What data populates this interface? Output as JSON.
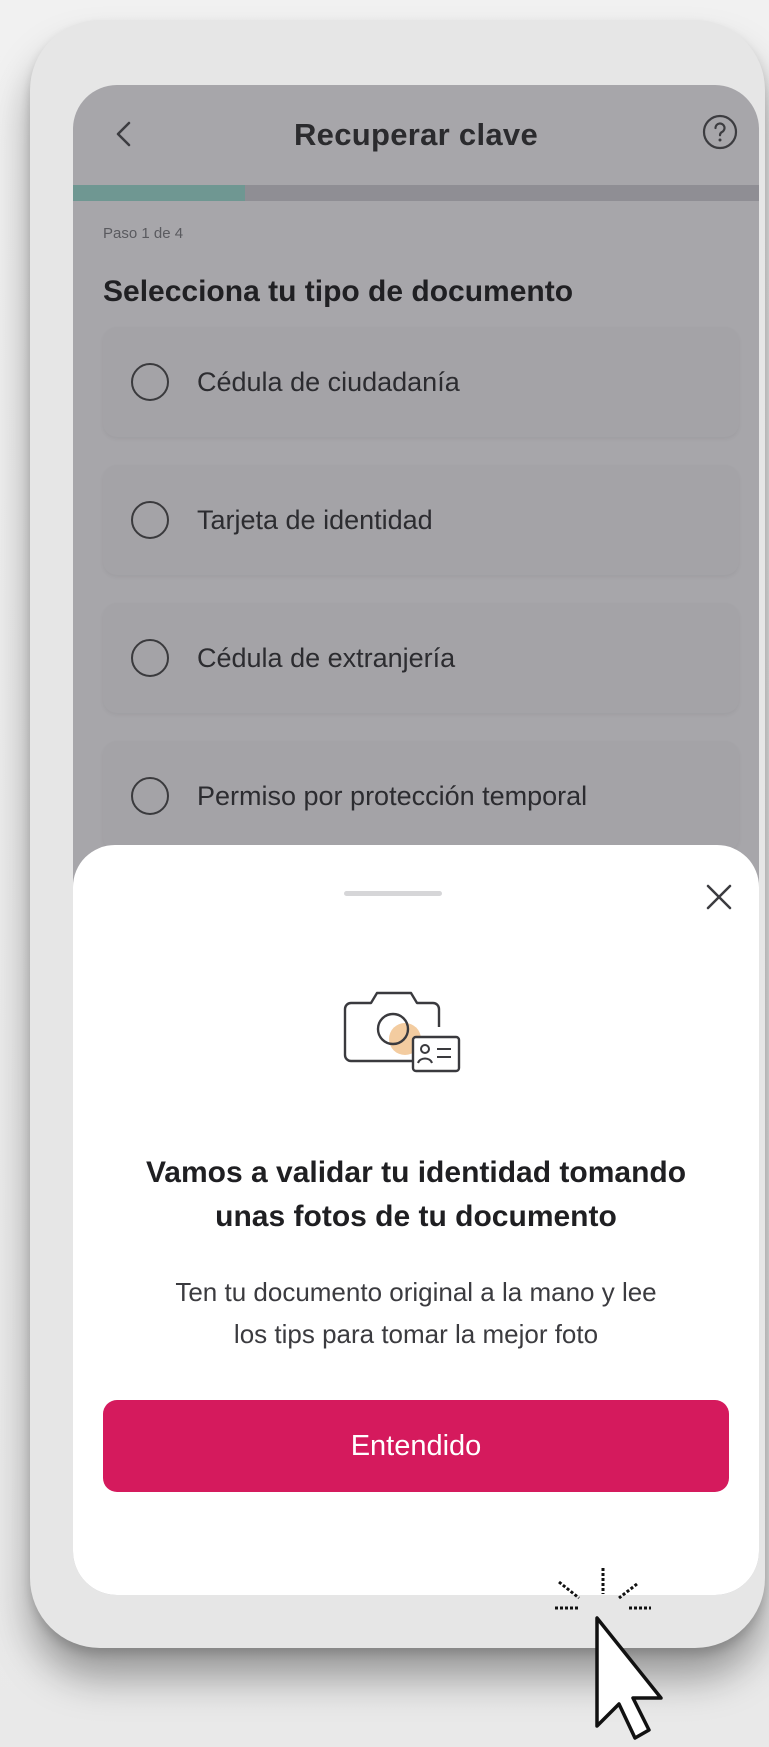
{
  "header": {
    "title": "Recuperar clave",
    "back_icon": "chevron-left-icon",
    "help_icon": "question-circle-icon"
  },
  "progress": {
    "current_step": 1,
    "total_steps": 4,
    "fraction": 0.25
  },
  "step_label": "Paso 1 de 4",
  "question": "Selecciona tu tipo de documento",
  "options": [
    {
      "label": "Cédula de ciudadanía",
      "selected": false
    },
    {
      "label": "Tarjeta de identidad",
      "selected": false
    },
    {
      "label": "Cédula de extranjería",
      "selected": false
    },
    {
      "label": "Permiso por protección temporal",
      "selected": false
    }
  ],
  "sheet": {
    "close_icon": "close-icon",
    "illustration_icon": "camera-id-card-icon",
    "title_line1": "Vamos a validar tu identidad tomando",
    "title_line2": "unas fotos de tu documento",
    "desc_line1": "Ten tu documento original a la mano y lee",
    "desc_line2": "los tips para tomar la mejor foto",
    "cta_label": "Entendido"
  },
  "colors": {
    "accent": "#d51a5d",
    "progress_fill": "#6f9792",
    "overlay": "#a7a6aa"
  }
}
